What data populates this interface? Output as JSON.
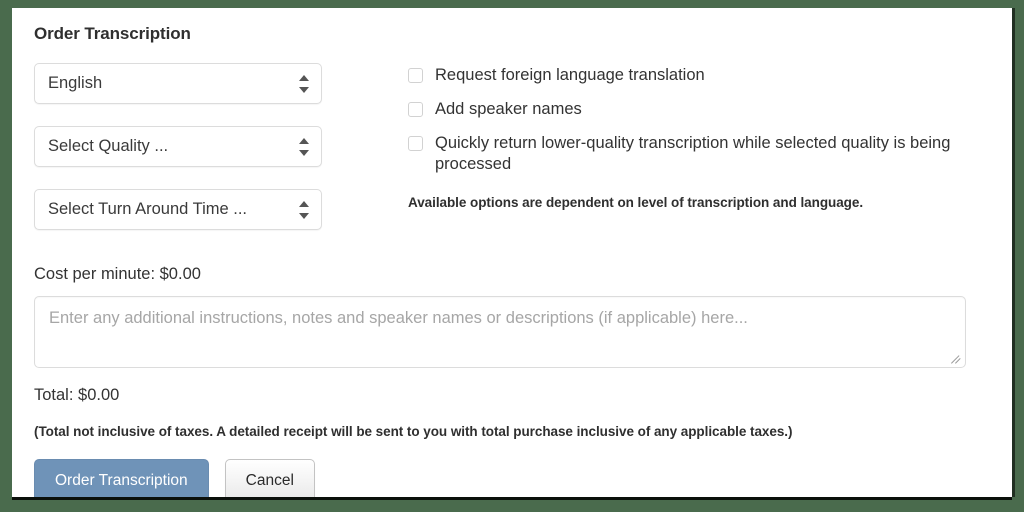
{
  "form": {
    "title": "Order Transcription",
    "selects": [
      {
        "name": "language",
        "value": "English"
      },
      {
        "name": "quality",
        "value": "Select Quality ..."
      },
      {
        "name": "turnaround",
        "value": "Select Turn Around Time ..."
      }
    ],
    "checkboxes": [
      {
        "name": "translation",
        "label": "Request foreign language translation",
        "checked": false
      },
      {
        "name": "speaker-names",
        "label": "Add speaker names",
        "checked": false
      },
      {
        "name": "quick-return",
        "label": "Quickly return lower-quality transcription while selected quality is being processed",
        "checked": false
      }
    ],
    "options_note": "Available options are dependent on level of transcription and language.",
    "cost_per_minute_label": "Cost per minute: $0.00",
    "notes_placeholder": "Enter any additional instructions, notes and speaker names or descriptions (if applicable) here...",
    "notes_value": "",
    "total_label": "Total: $0.00",
    "tax_note": "(Total not inclusive of taxes. A detailed receipt will be sent to you with total purchase inclusive of any applicable taxes.)",
    "buttons": {
      "submit": "Order Transcription",
      "cancel": "Cancel"
    }
  },
  "colors": {
    "page_background": "#4a6b4d",
    "panel_background": "#ffffff",
    "primary_button": "#6f93b8",
    "text": "#333333",
    "placeholder": "#a6a6a6",
    "field_border": "#dcdcdc"
  }
}
